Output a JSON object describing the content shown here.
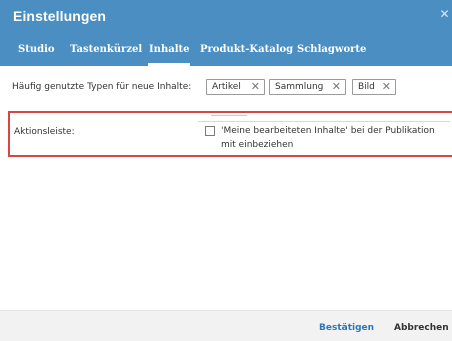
{
  "dialog": {
    "title": "Einstellungen",
    "close_glyph": "✕"
  },
  "tabs": [
    {
      "label": "Studio",
      "active": false
    },
    {
      "label": "Tastenkürzel",
      "active": false
    },
    {
      "label": "Inhalte",
      "active": true
    },
    {
      "label": "Produkt-Katalog",
      "active": false
    },
    {
      "label": "Schlagworte",
      "active": false
    }
  ],
  "content": {
    "types_label": "Häufig genutzte Typen für neue Inhalte:",
    "types_tags": [
      {
        "label": "Artikel",
        "remove_glyph": "✕"
      },
      {
        "label": "Sammlung",
        "remove_glyph": "✕"
      },
      {
        "label": "Bild",
        "remove_glyph": "✕"
      }
    ],
    "toolbar_label": "Aktionsleiste:",
    "toolbar_checkbox": {
      "label": "'Meine bearbeiteten Inhalte' bei der Publikation mit einbeziehen",
      "checked": false
    }
  },
  "footer": {
    "confirm_label": "Bestätigen",
    "cancel_label": "Abbrechen"
  },
  "colors": {
    "header": "#4a8ec2",
    "highlight": "#d9453f",
    "confirm": "#2f76b8"
  },
  "icons": {
    "close": "close-icon",
    "tag_remove": "remove-tag-icon",
    "checkbox": "checkbox-unchecked-icon"
  }
}
